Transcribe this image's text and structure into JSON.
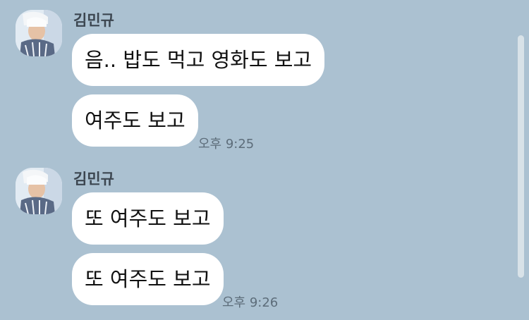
{
  "groups": [
    {
      "sender": "김민규",
      "messages": [
        "음.. 밥도 먹고 영화도 보고",
        "여주도 보고"
      ],
      "time": "오후 9:25"
    },
    {
      "sender": "김민규",
      "messages": [
        "또 여주도 보고",
        "또 여주도 보고"
      ],
      "time": "오후 9:26"
    }
  ]
}
